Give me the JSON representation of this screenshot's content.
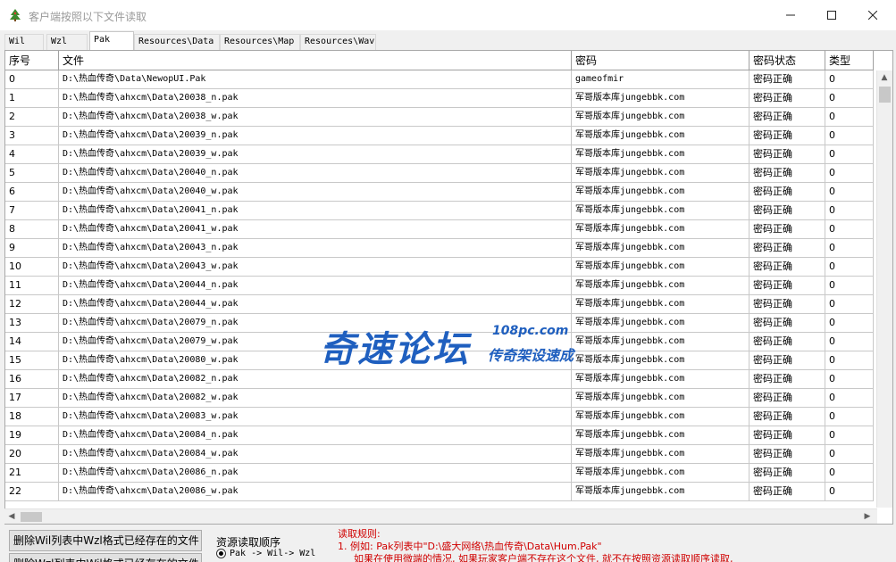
{
  "window": {
    "title": "客户端按照以下文件读取",
    "minimize_glyph": "—",
    "maximize_glyph": "☐",
    "close_glyph": "✕",
    "icon": "app-tree-icon"
  },
  "tabs": [
    {
      "label": "Wil"
    },
    {
      "label": "Wzl"
    },
    {
      "label": "Pak",
      "active": true
    },
    {
      "label": "Resources\\Data"
    },
    {
      "label": "Resources\\Map"
    },
    {
      "label": "Resources\\Wav"
    }
  ],
  "table": {
    "headers": [
      "序号",
      "文件",
      "密码",
      "密码状态",
      "类型"
    ],
    "rows": [
      [
        "0",
        "D:\\热血传奇\\Data\\NewopUI.Pak",
        "gameofmir",
        "密码正确",
        "0"
      ],
      [
        "1",
        "D:\\热血传奇\\ahxcm\\Data\\20038_n.pak",
        "军哥版本库jungebbk.com",
        "密码正确",
        "0"
      ],
      [
        "2",
        "D:\\热血传奇\\ahxcm\\Data\\20038_w.pak",
        "军哥版本库jungebbk.com",
        "密码正确",
        "0"
      ],
      [
        "3",
        "D:\\热血传奇\\ahxcm\\Data\\20039_n.pak",
        "军哥版本库jungebbk.com",
        "密码正确",
        "0"
      ],
      [
        "4",
        "D:\\热血传奇\\ahxcm\\Data\\20039_w.pak",
        "军哥版本库jungebbk.com",
        "密码正确",
        "0"
      ],
      [
        "5",
        "D:\\热血传奇\\ahxcm\\Data\\20040_n.pak",
        "军哥版本库jungebbk.com",
        "密码正确",
        "0"
      ],
      [
        "6",
        "D:\\热血传奇\\ahxcm\\Data\\20040_w.pak",
        "军哥版本库jungebbk.com",
        "密码正确",
        "0"
      ],
      [
        "7",
        "D:\\热血传奇\\ahxcm\\Data\\20041_n.pak",
        "军哥版本库jungebbk.com",
        "密码正确",
        "0"
      ],
      [
        "8",
        "D:\\热血传奇\\ahxcm\\Data\\20041_w.pak",
        "军哥版本库jungebbk.com",
        "密码正确",
        "0"
      ],
      [
        "9",
        "D:\\热血传奇\\ahxcm\\Data\\20043_n.pak",
        "军哥版本库jungebbk.com",
        "密码正确",
        "0"
      ],
      [
        "10",
        "D:\\热血传奇\\ahxcm\\Data\\20043_w.pak",
        "军哥版本库jungebbk.com",
        "密码正确",
        "0"
      ],
      [
        "11",
        "D:\\热血传奇\\ahxcm\\Data\\20044_n.pak",
        "军哥版本库jungebbk.com",
        "密码正确",
        "0"
      ],
      [
        "12",
        "D:\\热血传奇\\ahxcm\\Data\\20044_w.pak",
        "军哥版本库jungebbk.com",
        "密码正确",
        "0"
      ],
      [
        "13",
        "D:\\热血传奇\\ahxcm\\Data\\20079_n.pak",
        "军哥版本库jungebbk.com",
        "密码正确",
        "0"
      ],
      [
        "14",
        "D:\\热血传奇\\ahxcm\\Data\\20079_w.pak",
        "军哥版本库jungebbk.com",
        "密码正确",
        "0"
      ],
      [
        "15",
        "D:\\热血传奇\\ahxcm\\Data\\20080_w.pak",
        "军哥版本库jungebbk.com",
        "密码正确",
        "0"
      ],
      [
        "16",
        "D:\\热血传奇\\ahxcm\\Data\\20082_n.pak",
        "军哥版本库jungebbk.com",
        "密码正确",
        "0"
      ],
      [
        "17",
        "D:\\热血传奇\\ahxcm\\Data\\20082_w.pak",
        "军哥版本库jungebbk.com",
        "密码正确",
        "0"
      ],
      [
        "18",
        "D:\\热血传奇\\ahxcm\\Data\\20083_w.pak",
        "军哥版本库jungebbk.com",
        "密码正确",
        "0"
      ],
      [
        "19",
        "D:\\热血传奇\\ahxcm\\Data\\20084_n.pak",
        "军哥版本库jungebbk.com",
        "密码正确",
        "0"
      ],
      [
        "20",
        "D:\\热血传奇\\ahxcm\\Data\\20084_w.pak",
        "军哥版本库jungebbk.com",
        "密码正确",
        "0"
      ],
      [
        "21",
        "D:\\热血传奇\\ahxcm\\Data\\20086_n.pak",
        "军哥版本库jungebbk.com",
        "密码正确",
        "0"
      ],
      [
        "22",
        "D:\\热血传奇\\ahxcm\\Data\\20086_w.pak",
        "军哥版本库jungebbk.com",
        "密码正确",
        "0"
      ]
    ]
  },
  "watermark": {
    "main": "奇速论坛",
    "url": "108pc.com",
    "sub": "传奇架设速成",
    "color": "#1f5fbf"
  },
  "bottom": {
    "button1": "删除Wil列表中Wzl格式已经存在的文件",
    "button2": "删除Wzl列表中Wil格式已经存在的文件",
    "resource_order_label": "资源读取顺序",
    "radio_option": "Pak -> Wil-> Wzl",
    "rules_title": "读取规则:",
    "rules_line1": "1. 例如: Pak列表中\"D:\\盛大网络\\热血传奇\\Data\\Hum.Pak\"",
    "rules_line2": "如果在使用微端的情况, 如果玩家客户端不存在这个文件, 就不在按照资源读取顺序读取,",
    "rules_color": "#d00000"
  }
}
